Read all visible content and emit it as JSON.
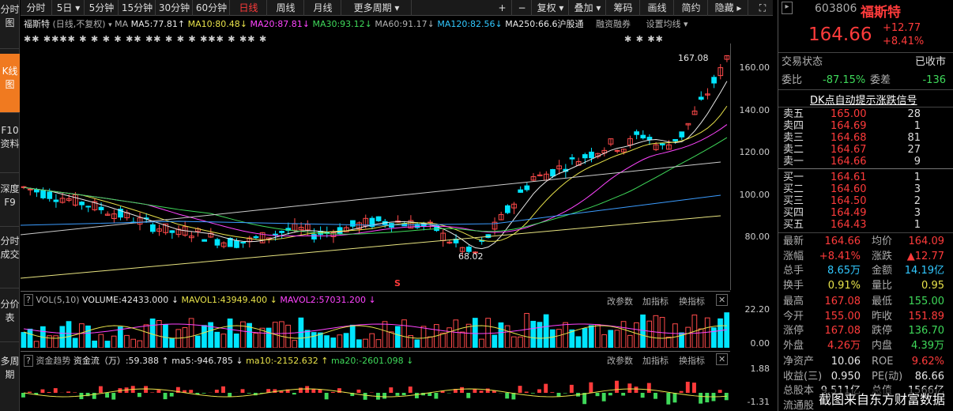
{
  "sidebar": [
    "分时图",
    "K线图",
    "F10资料",
    "深度F9",
    "分时成交",
    "分价表",
    "多周期"
  ],
  "toolbar": {
    "items": [
      "分时",
      "5日 ▾",
      "5分钟",
      "15分钟",
      "30分钟",
      "60分钟",
      "日线",
      "周线",
      "月线",
      "更多周期 ▾"
    ],
    "right": [
      "+",
      "−",
      "复权 ▾",
      "叠加 ▾",
      "筹码",
      "画线",
      "简约",
      "隐藏 ▸"
    ]
  },
  "chart_header": {
    "name": "福斯特",
    "mode": "(日线,不复权)",
    "ma_label": "MA",
    "ma": [
      {
        "t": "MA5:77.81",
        "a": "↑"
      },
      {
        "t": "MA10:80.48",
        "a": "↓"
      },
      {
        "t": "MA20:87.81",
        "a": "↓"
      },
      {
        "t": "MA30:93.12",
        "a": "↓"
      },
      {
        "t": "MA60:91.17",
        "a": "↓"
      },
      {
        "t": "MA120:82.56",
        "a": "↓"
      },
      {
        "t": "MA250:66.6",
        "a": ""
      }
    ],
    "hgt": "沪股通",
    "margin": "融资融券",
    "settings": "设置均线 ▾"
  },
  "stars_left": "✱✱ ✱✱✱✱     ✱     ✱  ✱     ✱    ✱✱ ✱✱ ✱   ✱   ✱  ✱✱✱     ✱ ✱✱   ✱",
  "stars_right": "✱   ✱      ✱✱",
  "price_axis": [
    "160.00",
    "140.00",
    "120.00",
    "100.00",
    "80.00"
  ],
  "marks": {
    "high": "167.08",
    "low": "68.02",
    "s": "S"
  },
  "vol_header": {
    "title": "VOL(5,10)",
    "volume": "VOLUME:42433.000",
    "mavol1": "MAVOL1:43949.400",
    "mavol2": "MAVOL2:57031.200",
    "arrow1": "↓",
    "arrow2": "↓"
  },
  "vol_axis": [
    "22.20",
    "0.00"
  ],
  "fund_header": {
    "title": "资金趋势",
    "flow": "资金流（万）:59.388",
    "a1": "↑",
    "ma5": "ma5:-946.785",
    "a2": "↓",
    "ma10": "ma10:-2152.632",
    "a3": "↑",
    "ma20": "ma20:-2601.098",
    "a4": "↓"
  },
  "fund_axis": [
    "1.88",
    "-1.31"
  ],
  "panel_btns": {
    "params": "改参数",
    "add": "加指标",
    "swap": "换指标",
    "close": "✕"
  },
  "quote": {
    "code": "603806",
    "name": "福斯特",
    "price": "164.66",
    "change": "+12.77",
    "pct": "+8.41%",
    "status_label": "交易状态",
    "status": "已收市",
    "wb_label": "委比",
    "wb": "-87.15%",
    "wc_label": "委差",
    "wc": "-136",
    "dk": "DK点自动提示涨跌信号"
  },
  "asks": [
    {
      "l": "卖五",
      "p": "165.00",
      "v": "28"
    },
    {
      "l": "卖四",
      "p": "164.69",
      "v": "1"
    },
    {
      "l": "卖三",
      "p": "164.68",
      "v": "81"
    },
    {
      "l": "卖二",
      "p": "164.67",
      "v": "27"
    },
    {
      "l": "卖一",
      "p": "164.66",
      "v": "9"
    }
  ],
  "bids": [
    {
      "l": "买一",
      "p": "164.61",
      "v": "1"
    },
    {
      "l": "买二",
      "p": "164.60",
      "v": "3"
    },
    {
      "l": "买三",
      "p": "164.50",
      "v": "2"
    },
    {
      "l": "买四",
      "p": "164.49",
      "v": "3"
    },
    {
      "l": "买五",
      "p": "164.43",
      "v": "1"
    }
  ],
  "stats": [
    [
      "最新",
      "164.66",
      "均价",
      "164.09"
    ],
    [
      "涨幅",
      "+8.41%",
      "涨跌",
      "▲12.77"
    ],
    [
      "总手",
      "8.65万",
      "金额",
      "14.19亿"
    ],
    [
      "换手",
      "0.91%",
      "量比",
      "0.95"
    ],
    [
      "最高",
      "167.08",
      "最低",
      "155.00"
    ],
    [
      "今开",
      "155.00",
      "昨收",
      "151.89"
    ],
    [
      "涨停",
      "167.08",
      "跌停",
      "136.70"
    ],
    [
      "外盘",
      "4.26万",
      "内盘",
      "4.39万"
    ],
    [
      "净资产",
      "10.06",
      "ROE",
      "9.62%"
    ],
    [
      "收益(三)",
      "0.950",
      "PE(动)",
      "86.66"
    ],
    [
      "总股本",
      "9.511亿",
      "总值",
      "1566亿"
    ],
    [
      "流通股",
      "",
      "",
      ""
    ]
  ],
  "watermark": "截图来自东方财富数据"
}
